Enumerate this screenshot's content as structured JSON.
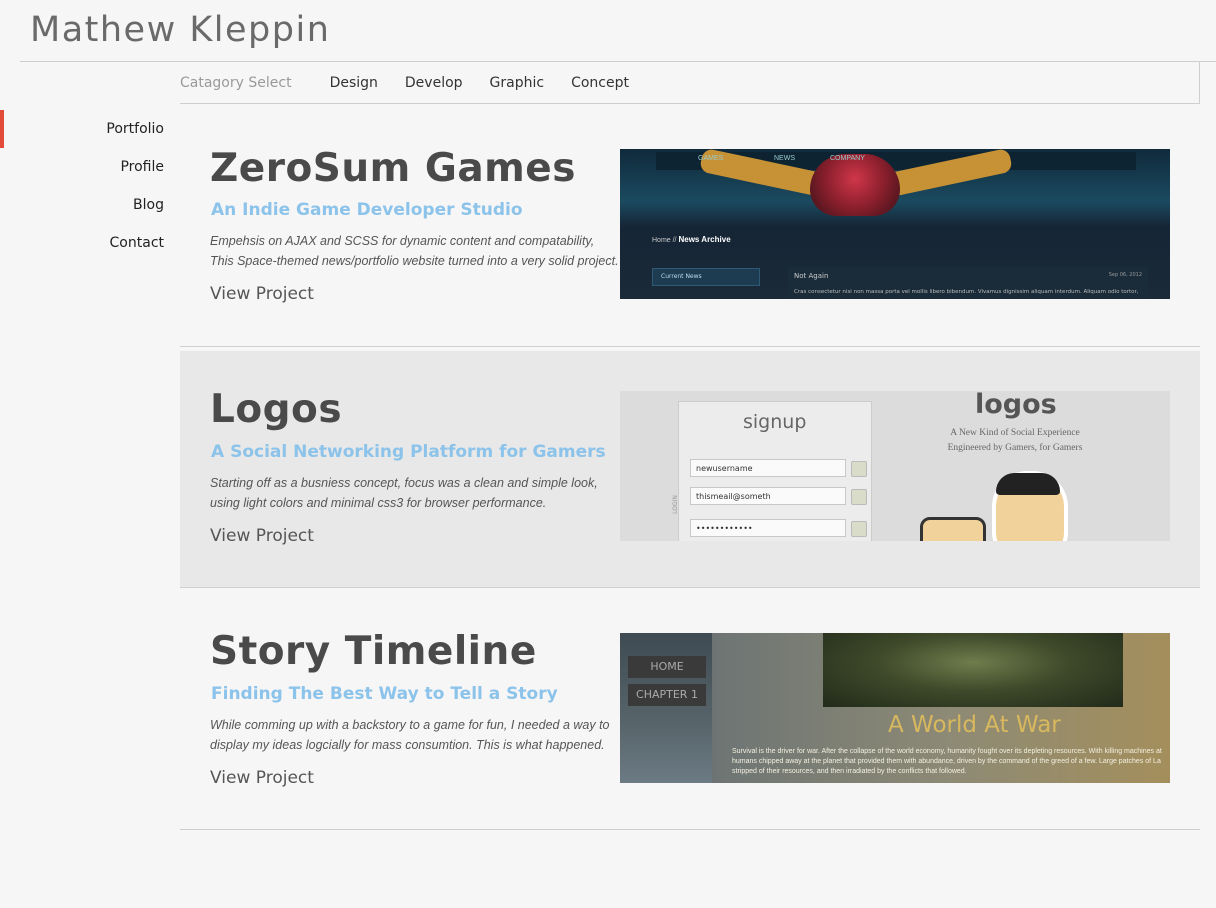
{
  "header": {
    "site_title": "Mathew Kleppin"
  },
  "category_bar": {
    "label": "Catagory Select",
    "items": [
      "Design",
      "Develop",
      "Graphic",
      "Concept"
    ]
  },
  "sidenav": {
    "items": [
      "Portfolio",
      "Profile",
      "Blog",
      "Contact"
    ],
    "active": "Portfolio"
  },
  "colors": {
    "accent": "#e24b37",
    "subtitle": "#8cc3ea",
    "alt_row_bg": "#e8e8e8"
  },
  "projects": [
    {
      "title": "ZeroSum Games",
      "subtitle": "An Indie Game Developer Studio",
      "description": "Empehsis on AJAX and SCSS for dynamic content and compatability, This Space-themed news/portfolio website turned into a very solid project.",
      "link": "View Project",
      "thumbnail": {
        "nav": [
          "GAMES",
          "NEWS",
          "COMPANY"
        ],
        "crumb_prefix": "Home //",
        "crumb_current": "News Archive",
        "panel_left": "Current News",
        "post_title": "Not Again",
        "post_date": "Sep 06, 2012",
        "post_text": "Cras consectetur nisi non massa porta vel mollis libero bibendum. Vivamus dignissim aliquam interdum. Aliquam odio tortor,"
      }
    },
    {
      "title": "Logos",
      "subtitle": "A Social Networking Platform for Gamers",
      "description": "Starting off as a busniess concept, focus was a clean and simple look, using light colors and minimal css3 for browser performance.",
      "link": "View Project",
      "thumbnail": {
        "form_title": "signup",
        "fields": [
          "newusername",
          "thismeail@someth",
          "••••••••••••"
        ],
        "side_label": "LOGIN",
        "brand": "logos",
        "tagline_1": "A New Kind of Social Experience",
        "tagline_2": "Engineered by Gamers, for Gamers"
      }
    },
    {
      "title": "Story Timeline",
      "subtitle": "Finding The Best Way to Tell a Story",
      "description": "While comming up with a backstory to a game for fun, I needed a way to display my ideas logcially for mass consumtion. This is what happened.",
      "link": "View Project",
      "thumbnail": {
        "buttons": [
          "HOME",
          "CHAPTER 1"
        ],
        "heading": "A World At War",
        "text": "Survival is the driver for war. After the collapse of the world economy, humanity fought over its depleting resources. With killing machines at humans chipped away at the planet that provided them with abundance, driven by the command of the greed of a few. Large patches of La stripped of their resources, and then irradiated by the conflicts that followed."
      }
    }
  ]
}
